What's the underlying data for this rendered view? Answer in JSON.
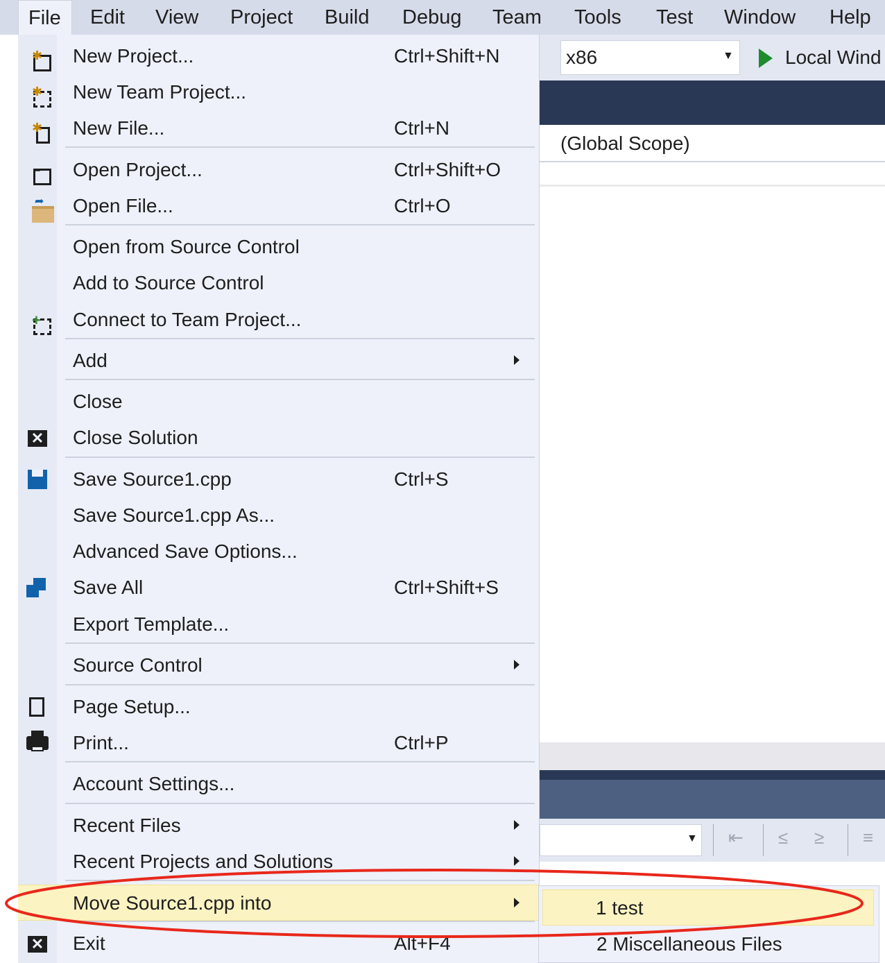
{
  "menubar": {
    "items": [
      "File",
      "Edit",
      "View",
      "Project",
      "Build",
      "Debug",
      "Team",
      "Tools",
      "Test",
      "Window",
      "Help"
    ]
  },
  "toolbar": {
    "platform": "x86",
    "run_label": "Local Wind"
  },
  "navbar": {
    "scope": "(Global Scope)"
  },
  "file_menu": {
    "items": [
      {
        "label": "New Project...",
        "shortcut": "Ctrl+Shift+N",
        "icon": "new-project-icon"
      },
      {
        "label": "New Team Project...",
        "shortcut": "",
        "icon": "new-team-project-icon"
      },
      {
        "label": "New File...",
        "shortcut": "Ctrl+N",
        "icon": "new-file-icon"
      },
      {
        "label": "Open Project...",
        "shortcut": "Ctrl+Shift+O",
        "icon": "open-project-icon"
      },
      {
        "label": "Open File...",
        "shortcut": "Ctrl+O",
        "icon": "open-file-icon"
      },
      {
        "label": "Open from Source Control",
        "shortcut": ""
      },
      {
        "label": "Add to Source Control",
        "shortcut": ""
      },
      {
        "label": "Connect to Team Project...",
        "shortcut": "",
        "icon": "connect-team-project-icon"
      },
      {
        "label": "Add",
        "shortcut": "",
        "submenu": true
      },
      {
        "label": "Close",
        "shortcut": ""
      },
      {
        "label": "Close Solution",
        "shortcut": "",
        "icon": "close-solution-icon"
      },
      {
        "label": "Save Source1.cpp",
        "shortcut": "Ctrl+S",
        "icon": "save-icon"
      },
      {
        "label": "Save Source1.cpp As...",
        "shortcut": ""
      },
      {
        "label": "Advanced Save Options...",
        "shortcut": ""
      },
      {
        "label": "Save All",
        "shortcut": "Ctrl+Shift+S",
        "icon": "save-all-icon"
      },
      {
        "label": "Export Template...",
        "shortcut": ""
      },
      {
        "label": "Source Control",
        "shortcut": "",
        "submenu": true
      },
      {
        "label": "Page Setup...",
        "shortcut": "",
        "icon": "page-setup-icon"
      },
      {
        "label": "Print...",
        "shortcut": "Ctrl+P",
        "icon": "print-icon"
      },
      {
        "label": "Account Settings...",
        "shortcut": ""
      },
      {
        "label": "Recent Files",
        "shortcut": "",
        "submenu": true
      },
      {
        "label": "Recent Projects and Solutions",
        "shortcut": "",
        "submenu": true
      },
      {
        "label": "Move Source1.cpp into",
        "shortcut": "",
        "submenu": true,
        "highlighted": true
      },
      {
        "label": "Exit",
        "shortcut": "Alt+F4",
        "icon": "exit-icon"
      }
    ]
  },
  "submenu": {
    "items": [
      {
        "label": "1 test",
        "highlighted": true
      },
      {
        "label": "2 Miscellaneous Files"
      }
    ]
  },
  "colors": {
    "menu_bg": "#eef1f9",
    "highlight": "#fcf3c2",
    "annotation": "#e8271b",
    "tab_bar": "#293955"
  }
}
